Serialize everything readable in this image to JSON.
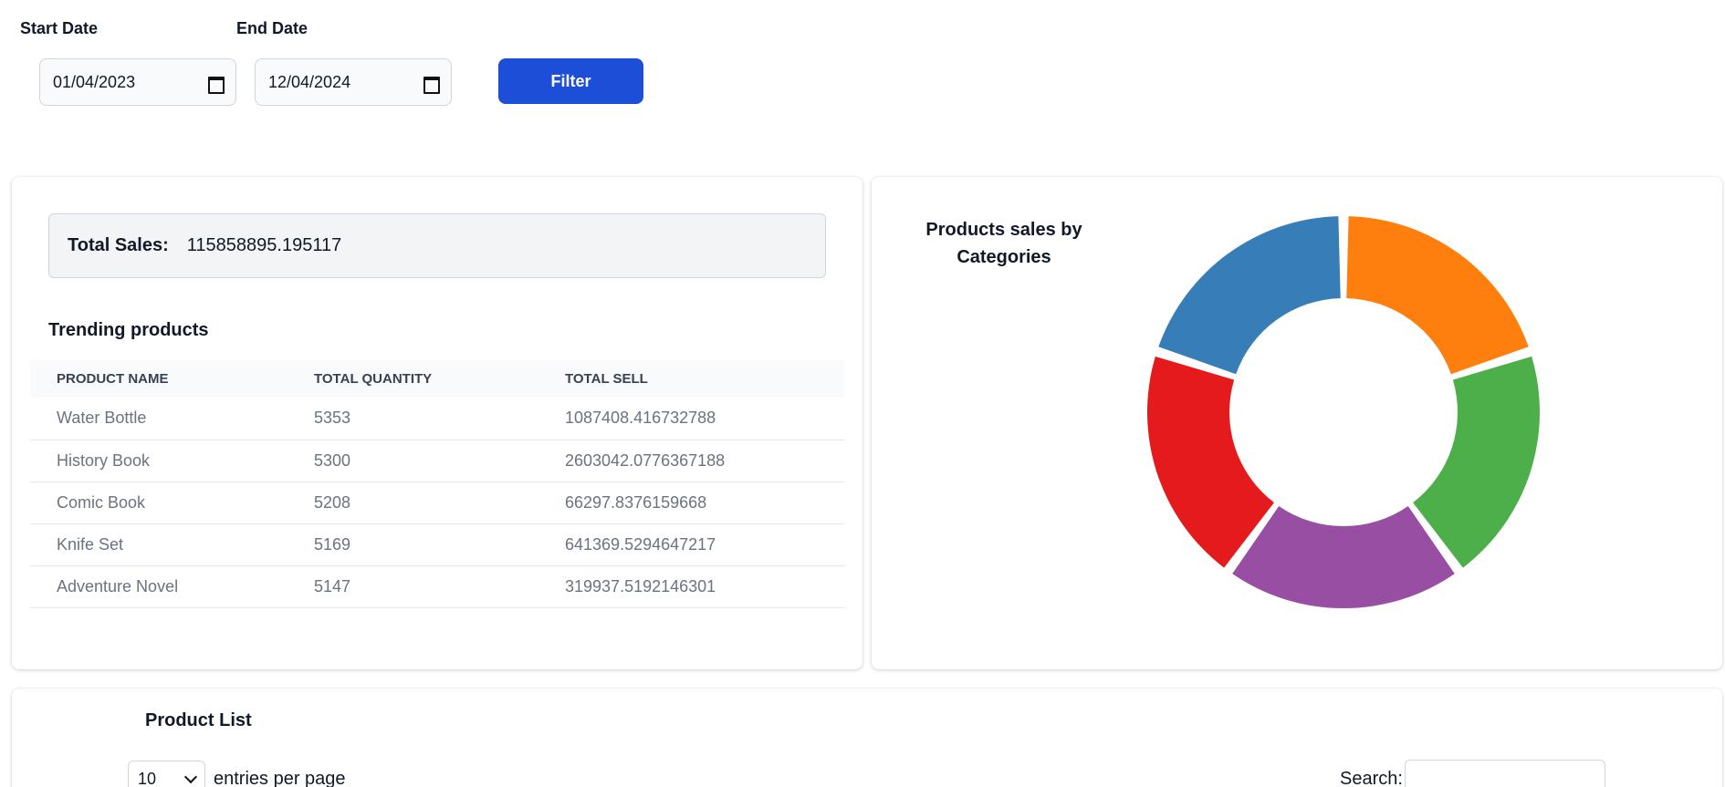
{
  "filters": {
    "start_label": "Start Date",
    "end_label": "End Date",
    "start_value": "01/04/2023",
    "end_value": "12/04/2024",
    "filter_button": "Filter"
  },
  "summary": {
    "total_label": "Total Sales:",
    "total_value": "115858895.195117"
  },
  "trending": {
    "title": "Trending products",
    "headers": [
      "PRODUCT NAME",
      "TOTAL QUANTITY",
      "TOTAL SELL"
    ],
    "rows": [
      [
        "Water Bottle",
        "5353",
        "1087408.416732788"
      ],
      [
        "History Book",
        "5300",
        "2603042.0776367188"
      ],
      [
        "Comic Book",
        "5208",
        "66297.8376159668"
      ],
      [
        "Knife Set",
        "5169",
        "641369.5294647217"
      ],
      [
        "Adventure Novel",
        "5147",
        "319937.5192146301"
      ]
    ]
  },
  "chart_data": {
    "type": "pie",
    "title": "Products sales by Categories",
    "legend": false,
    "slices": [
      {
        "value": 20,
        "color": "#ff7f0e"
      },
      {
        "value": 20,
        "color": "#4daf4a"
      },
      {
        "value": 20,
        "color": "#984ea3"
      },
      {
        "value": 20,
        "color": "#e41a1c"
      },
      {
        "value": 20,
        "color": "#377eb8"
      }
    ]
  },
  "product_list": {
    "title": "Product List",
    "entries_value": "10",
    "entries_text": "entries per page",
    "search_label": "Search:"
  },
  "colors": {
    "primary": "#1d4ed8",
    "panel_bg": "#f3f4f6"
  }
}
